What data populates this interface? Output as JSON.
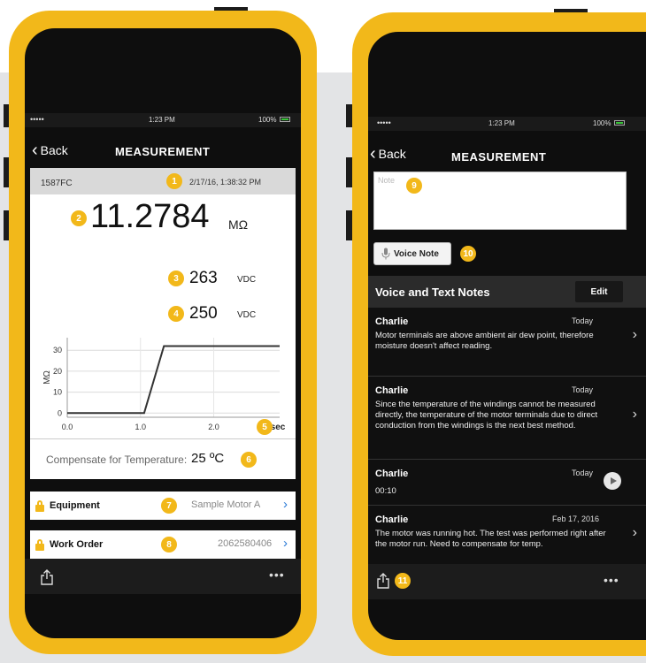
{
  "left_phone": {
    "status": {
      "signal": "•••••",
      "time": "1:23 PM",
      "battery": "100%"
    },
    "nav": {
      "back_label": "Back",
      "title": "MEASUREMENT"
    },
    "header": {
      "device": "1587FC",
      "datetime": "2/17/16, 1:38:32 PM"
    },
    "readings": {
      "primary_value": "11.2784",
      "primary_unit": "MΩ",
      "second_value": "263",
      "second_unit": "VDC",
      "third_value": "250",
      "third_unit": "VDC"
    },
    "badges": [
      "1",
      "2",
      "3",
      "4",
      "5",
      "6",
      "7",
      "8"
    ],
    "compensate": {
      "label": "Compensate for Temperature:",
      "value": "25 ºC"
    },
    "equipment": {
      "label": "Equipment",
      "value": "Sample Motor A"
    },
    "work_order": {
      "label": "Work Order",
      "value": "2062580406"
    },
    "footer": {
      "more": "•••"
    }
  },
  "chart_data": {
    "type": "line",
    "x": [
      0.0,
      1.05,
      1.32,
      2.9
    ],
    "series": [
      {
        "values": [
          0,
          0,
          32,
          32
        ]
      }
    ],
    "xlabel": "sec",
    "ylabel": "MΩ",
    "xlim": [
      0.0,
      2.9
    ],
    "ylim": [
      -2,
      36
    ],
    "xticks": [
      "0.0",
      "1.0",
      "2.0"
    ],
    "yticks": [
      "0",
      "10",
      "20",
      "30"
    ],
    "grid": true
  },
  "right_phone": {
    "status": {
      "signal": "•••••",
      "time": "1:23 PM",
      "battery": "100%"
    },
    "nav": {
      "back_label": "Back",
      "title": "MEASUREMENT"
    },
    "note_placeholder": "Note",
    "voice_note_label": "Voice Note",
    "badges": [
      "9",
      "10",
      "11"
    ],
    "notes_header": {
      "title": "Voice and Text Notes",
      "edit_label": "Edit"
    },
    "notes": [
      {
        "author": "Charlie",
        "date": "Today",
        "text": "Motor terminals are above ambient air dew point, therefore moisture doesn't affect reading."
      },
      {
        "author": "Charlie",
        "date": "Today",
        "text": "Since the temperature of the windings cannot be measured directly, the temperature of the motor terminals due to direct conduction from the windings is the next best method."
      },
      {
        "author": "Charlie",
        "date": "Today",
        "text": "00:10"
      },
      {
        "author": "Charlie",
        "date": "Feb 17, 2016",
        "text": "The motor was running hot. The test was performed right after the motor run. Need to compensate for temp."
      }
    ],
    "footer": {
      "more": "•••"
    }
  }
}
